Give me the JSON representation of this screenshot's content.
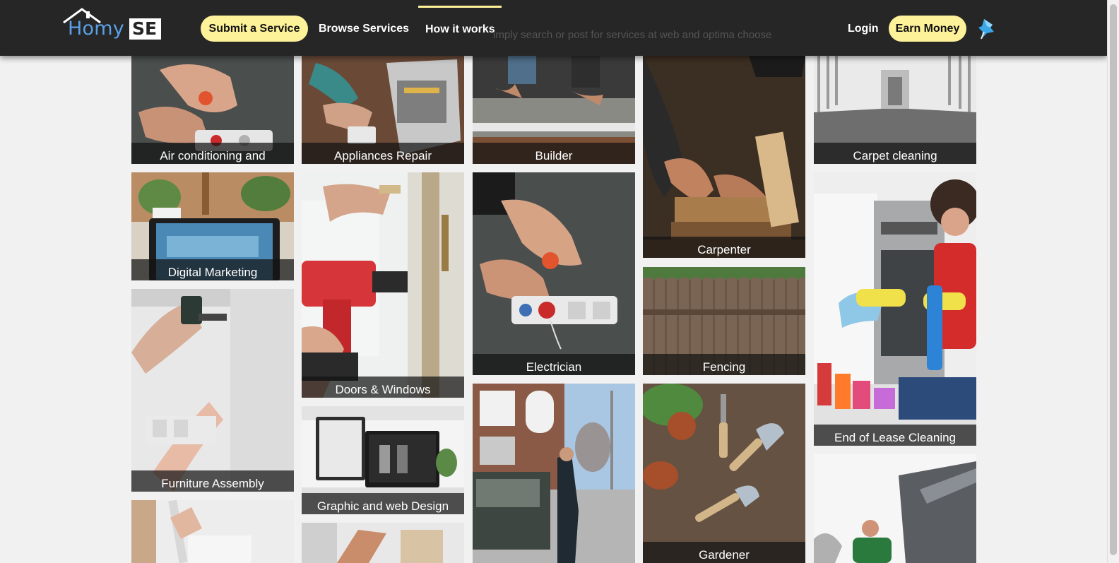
{
  "nav": {
    "logo_primary": "Homy",
    "logo_secondary": "SE",
    "submit_service": "Submit a Service",
    "browse_services": "Browse Services",
    "how_it_works": "How it works",
    "login": "Login",
    "earn_money": "Earn Money",
    "behind_text": "imply search or post for services at web and optima choose"
  },
  "colors": {
    "topbar": "#262626",
    "accent_pill": "#fdf19a",
    "logo_blue": "#5aa0e6",
    "page_bg": "#f1f1f1"
  },
  "services": [
    {
      "label": "Air conditioning and",
      "icon": "electrician-hands-image"
    },
    {
      "label": "Appliances Repair",
      "icon": "computer-repair-image"
    },
    {
      "label": "Builder",
      "icon": "concrete-builder-image"
    },
    {
      "label": "Carpenter",
      "icon": "carpenter-sawing-image"
    },
    {
      "label": "Carpet cleaning",
      "icon": "carpet-hallway-image"
    },
    {
      "label": "Digital Marketing",
      "icon": "laptop-plants-image"
    },
    {
      "label": "Doors & Windows",
      "icon": "drill-door-image"
    },
    {
      "label": "Electrician",
      "icon": "power-socket-image"
    },
    {
      "label": "Fencing",
      "icon": "wooden-fence-image"
    },
    {
      "label": "End of Lease Cleaning",
      "icon": "woman-cleaning-oven-image"
    },
    {
      "label": "Furniture Assembly",
      "icon": "screwdriver-cabinet-image"
    },
    {
      "label": "Graphic and web Design",
      "icon": "desktop-monitors-image"
    },
    {
      "label": "",
      "icon": "street-truck-image"
    },
    {
      "label": "Gardener",
      "icon": "garden-tools-image"
    },
    {
      "label": "",
      "icon": "vacuum-cleaner-image"
    },
    {
      "label": "",
      "icon": "hands-tools-image"
    },
    {
      "label": "",
      "icon": "roof-worker-image"
    }
  ]
}
